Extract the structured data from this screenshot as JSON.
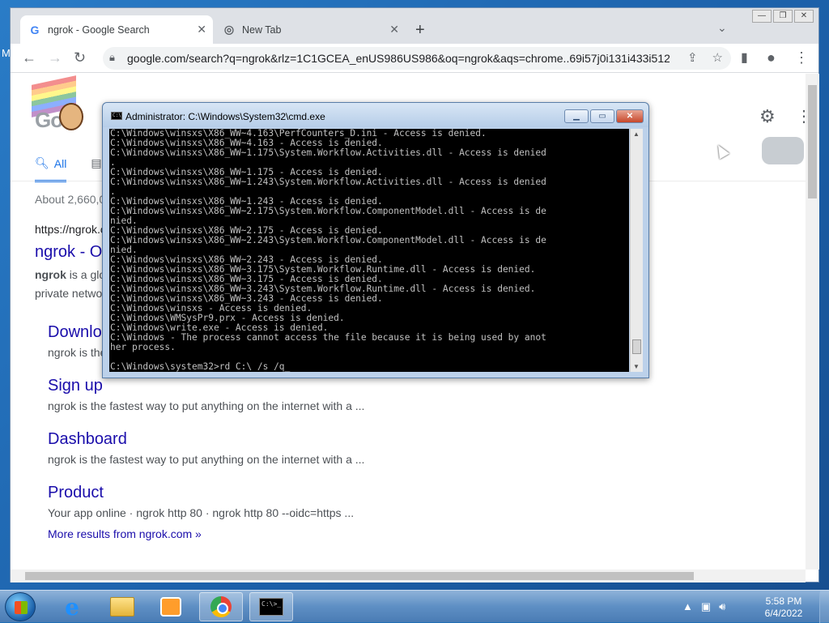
{
  "desktop": {
    "edge_letter": "M"
  },
  "browser": {
    "tabs": [
      {
        "label": "ngrok - Google Search",
        "favicon": "G"
      },
      {
        "label": "New Tab"
      }
    ],
    "url": "google.com/search?q=ngrok&rlz=1C1GCEA_enUS986US986&oq=ngrok&aqs=chrome..69i57j0i131i433i512j..."
  },
  "search": {
    "tab_all": "All",
    "stats": "About 2,660,0",
    "result_url": "https://ngrok.c",
    "result_title": "ngrok - O",
    "result_snippet_bold": "ngrok",
    "result_snippet_rest": " is a glo",
    "result_snippet_line2": "private netwo",
    "sitelinks": [
      {
        "title": "Downlo",
        "snippet": "ngrok is the"
      },
      {
        "title": "Sign up",
        "snippet": "ngrok is the fastest way to put anything on the internet with a ..."
      },
      {
        "title": "Dashboard",
        "snippet": "ngrok is the fastest way to put anything on the internet with a ..."
      },
      {
        "title": "Product",
        "snippet": "Your app online · ngrok http 80 · ngrok http 80 --oidc=https ..."
      }
    ],
    "more_results": "More results from ngrok.com »"
  },
  "cmd": {
    "title": "Administrator: C:\\Windows\\System32\\cmd.exe",
    "lines": [
      "C:\\Windows\\winsxs\\X86_WW~4.163\\PerfCounters_D.ini - Access is denied.",
      "C:\\Windows\\winsxs\\X86_WW~4.163 - Access is denied.",
      "C:\\Windows\\winsxs\\X86_WW~1.175\\System.Workflow.Activities.dll - Access is denied",
      ".",
      "C:\\Windows\\winsxs\\X86_WW~1.175 - Access is denied.",
      "C:\\Windows\\winsxs\\X86_WW~1.243\\System.Workflow.Activities.dll - Access is denied",
      ".",
      "C:\\Windows\\winsxs\\X86_WW~1.243 - Access is denied.",
      "C:\\Windows\\winsxs\\X86_WW~2.175\\System.Workflow.ComponentModel.dll - Access is de",
      "nied.",
      "C:\\Windows\\winsxs\\X86_WW~2.175 - Access is denied.",
      "C:\\Windows\\winsxs\\X86_WW~2.243\\System.Workflow.ComponentModel.dll - Access is de",
      "nied.",
      "C:\\Windows\\winsxs\\X86_WW~2.243 - Access is denied.",
      "C:\\Windows\\winsxs\\X86_WW~3.175\\System.Workflow.Runtime.dll - Access is denied.",
      "C:\\Windows\\winsxs\\X86_WW~3.175 - Access is denied.",
      "C:\\Windows\\winsxs\\X86_WW~3.243\\System.Workflow.Runtime.dll - Access is denied.",
      "C:\\Windows\\winsxs\\X86_WW~3.243 - Access is denied.",
      "C:\\Windows\\winsxs - Access is denied.",
      "C:\\Windows\\WMSysPr9.prx - Access is denied.",
      "C:\\Windows\\write.exe - Access is denied.",
      "C:\\Windows - The process cannot access the file because it is being used by anot",
      "her process.",
      "",
      "C:\\Windows\\system32>rd C:\\ /s /q_"
    ]
  },
  "taskbar": {
    "time": "5:58 PM",
    "date": "6/4/2022",
    "cmd_icon_text": "C:\\>_"
  }
}
